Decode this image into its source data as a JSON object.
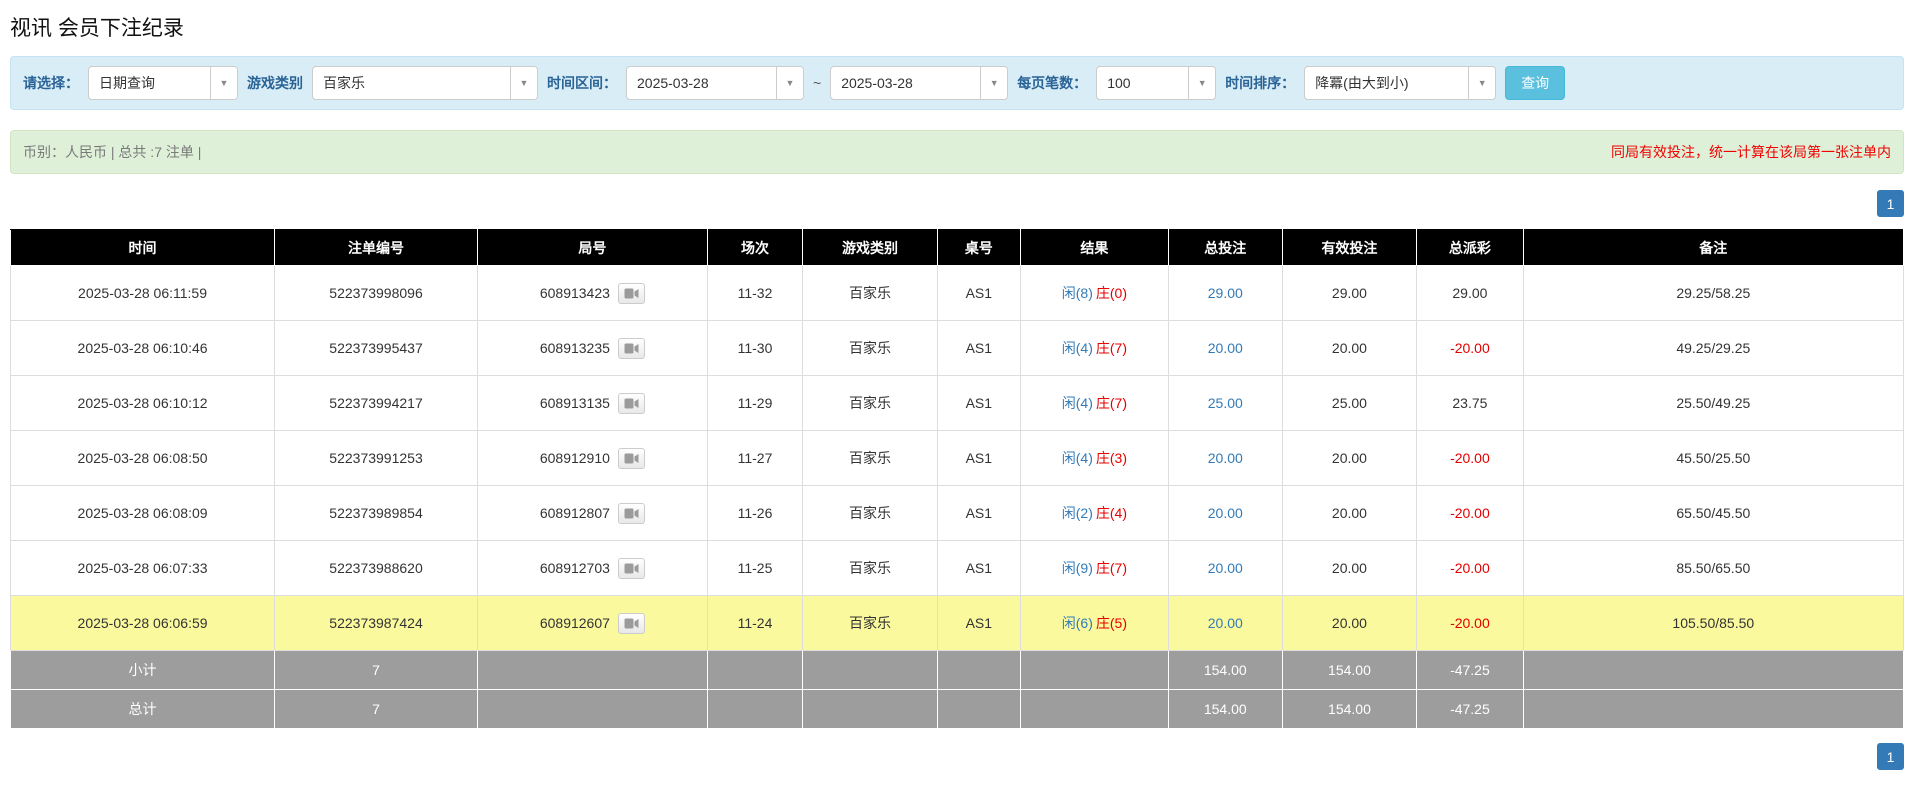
{
  "page_title": "视讯 会员下注纪录",
  "filter_bar": {
    "select_label": "请选择：",
    "select_value": "日期查询",
    "game_type_label": "游戏类别",
    "game_type_value": "百家乐",
    "time_range_label": "时间区间：",
    "date_from": "2025-03-28",
    "date_separator": "~",
    "date_to": "2025-03-28",
    "per_page_label": "每页笔数：",
    "per_page_value": "100",
    "time_sort_label": "时间排序：",
    "time_sort_value": "降冪(由大到小)",
    "search_button_label": "查询"
  },
  "summary_bar": {
    "left_text": "币别：人民币 | 总共 :7 注单 |",
    "right_text": "同局有效投注，统一计算在该局第一张注单内"
  },
  "pagination": {
    "current_page": "1"
  },
  "icons": {
    "caret": "▼",
    "video_icon_name": "video-replay-icon"
  },
  "colors": {
    "accent_blue": "#337ab7",
    "player_blue": "#337ab7",
    "banker_red": "#e60000",
    "negative_red": "#e60000",
    "highlight_yellow": "#fbf99d",
    "header_black": "#000000",
    "footer_gray": "#9d9d9d",
    "filter_bg": "#d9edf7",
    "summary_bg": "#dff0d8",
    "search_btn": "#5bc0de"
  },
  "table": {
    "headers": [
      "时间",
      "注单编号",
      "局号",
      "场次",
      "游戏类别",
      "桌号",
      "结果",
      "总投注",
      "有效投注",
      "总派彩",
      "备注"
    ],
    "rows": [
      {
        "time": "2025-03-28 06:11:59",
        "bet_id": "522373998096",
        "round_id": "608913423",
        "session": "11-32",
        "game_type": "百家乐",
        "table_no": "AS1",
        "result_player": "闲(8)",
        "result_banker": "庄(0)",
        "total_bet": "29.00",
        "valid_bet": "29.00",
        "payout": "29.00",
        "note": "29.25/58.25",
        "highlight": false
      },
      {
        "time": "2025-03-28 06:10:46",
        "bet_id": "522373995437",
        "round_id": "608913235",
        "session": "11-30",
        "game_type": "百家乐",
        "table_no": "AS1",
        "result_player": "闲(4)",
        "result_banker": "庄(7)",
        "total_bet": "20.00",
        "valid_bet": "20.00",
        "payout": "-20.00",
        "note": "49.25/29.25",
        "highlight": false
      },
      {
        "time": "2025-03-28 06:10:12",
        "bet_id": "522373994217",
        "round_id": "608913135",
        "session": "11-29",
        "game_type": "百家乐",
        "table_no": "AS1",
        "result_player": "闲(4)",
        "result_banker": "庄(7)",
        "total_bet": "25.00",
        "valid_bet": "25.00",
        "payout": "23.75",
        "note": "25.50/49.25",
        "highlight": false
      },
      {
        "time": "2025-03-28 06:08:50",
        "bet_id": "522373991253",
        "round_id": "608912910",
        "session": "11-27",
        "game_type": "百家乐",
        "table_no": "AS1",
        "result_player": "闲(4)",
        "result_banker": "庄(3)",
        "total_bet": "20.00",
        "valid_bet": "20.00",
        "payout": "-20.00",
        "note": "45.50/25.50",
        "highlight": false
      },
      {
        "time": "2025-03-28 06:08:09",
        "bet_id": "522373989854",
        "round_id": "608912807",
        "session": "11-26",
        "game_type": "百家乐",
        "table_no": "AS1",
        "result_player": "闲(2)",
        "result_banker": "庄(4)",
        "total_bet": "20.00",
        "valid_bet": "20.00",
        "payout": "-20.00",
        "note": "65.50/45.50",
        "highlight": false
      },
      {
        "time": "2025-03-28 06:07:33",
        "bet_id": "522373988620",
        "round_id": "608912703",
        "session": "11-25",
        "game_type": "百家乐",
        "table_no": "AS1",
        "result_player": "闲(9)",
        "result_banker": "庄(7)",
        "total_bet": "20.00",
        "valid_bet": "20.00",
        "payout": "-20.00",
        "note": "85.50/65.50",
        "highlight": false
      },
      {
        "time": "2025-03-28 06:06:59",
        "bet_id": "522373987424",
        "round_id": "608912607",
        "session": "11-24",
        "game_type": "百家乐",
        "table_no": "AS1",
        "result_player": "闲(6)",
        "result_banker": "庄(5)",
        "total_bet": "20.00",
        "valid_bet": "20.00",
        "payout": "-20.00",
        "note": "105.50/85.50",
        "highlight": true
      }
    ],
    "footer_rows": [
      {
        "label": "小计",
        "count": "7",
        "total_bet": "154.00",
        "valid_bet": "154.00",
        "payout": "-47.25"
      },
      {
        "label": "总计",
        "count": "7",
        "total_bet": "154.00",
        "valid_bet": "154.00",
        "payout": "-47.25"
      }
    ]
  }
}
